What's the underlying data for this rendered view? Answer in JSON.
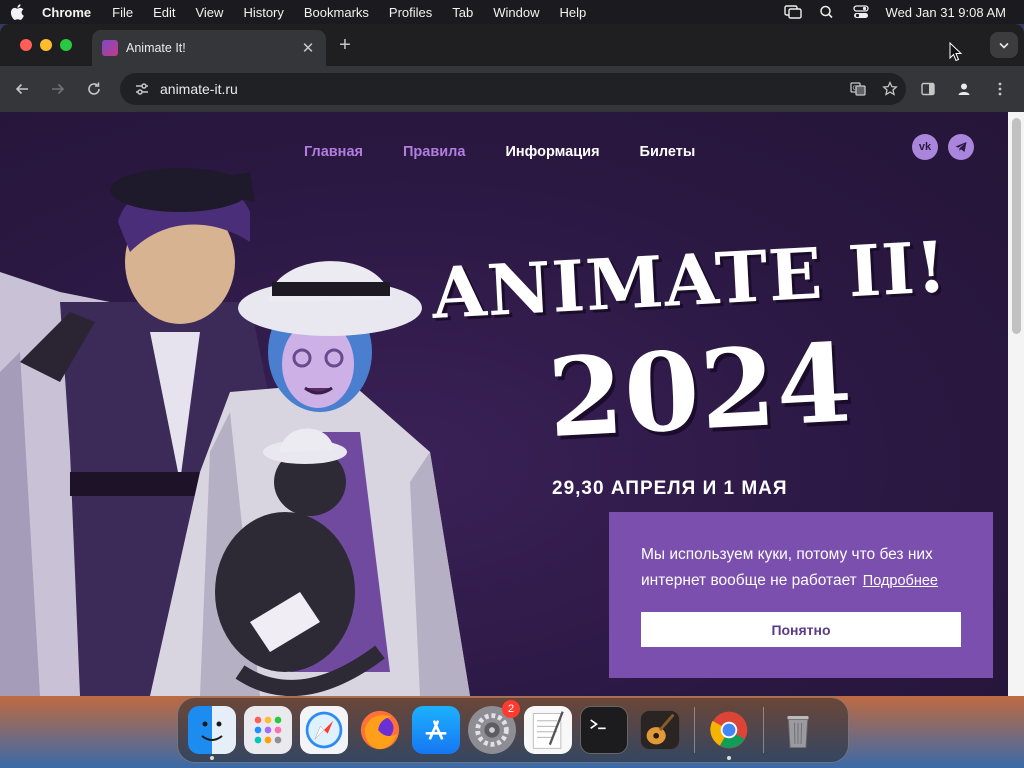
{
  "menubar": {
    "app_name": "Chrome",
    "items": [
      "File",
      "Edit",
      "View",
      "History",
      "Bookmarks",
      "Profiles",
      "Tab",
      "Window",
      "Help"
    ],
    "clock": "Wed Jan 31  9:08 AM"
  },
  "browser": {
    "tab_title": "Animate It!",
    "new_tab_symbol": "+",
    "tab_close_symbol": "✕",
    "url": "animate-it.ru"
  },
  "site": {
    "nav": [
      "Главная",
      "Правила",
      "Информация",
      "Билеты"
    ],
    "socials": [
      "vk",
      "telegram"
    ],
    "vk_label": "vk",
    "title_line1": "ANIMATE II!",
    "title_line2": "2024",
    "date": "29,30 АПРЕЛЯ И 1 МАЯ"
  },
  "cookie": {
    "text": "Мы используем куки, потому что без них интернет вообще не работает",
    "link": "Подробнее",
    "button": "Понятно"
  },
  "dock": {
    "apps": [
      "Finder",
      "Launchpad",
      "Safari",
      "Firefox",
      "App Store",
      "System Settings",
      "TextEdit",
      "Terminal",
      "GarageBand",
      "Chrome",
      "Trash"
    ],
    "settings_badge": "2"
  },
  "colors": {
    "page_bg": "#2b1843",
    "nav_violet": "#b07de0",
    "cookie_bg": "#7b4fae",
    "social_bg": "#a985dc"
  }
}
